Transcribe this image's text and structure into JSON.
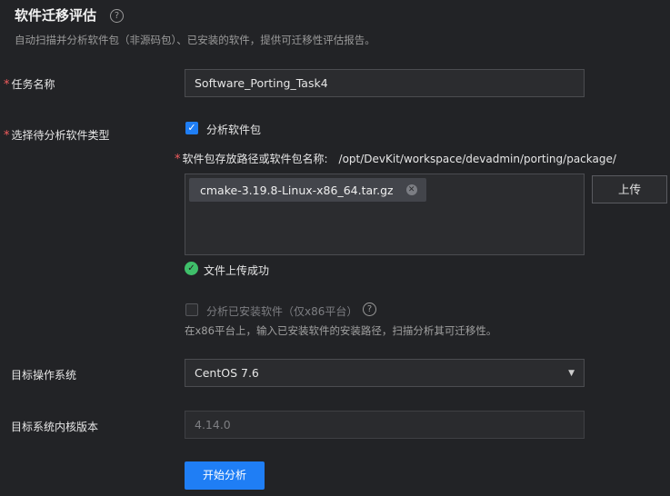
{
  "header": {
    "title": "软件迁移评估",
    "subtitle": "自动扫描并分析软件包（非源码包）、已安装的软件，提供可迁移性评估报告。"
  },
  "task_name": {
    "label": "任务名称",
    "value": "Software_Porting_Task4"
  },
  "software_type": {
    "label": "选择待分析软件类型",
    "analyze_package": {
      "label": "分析软件包",
      "checked": true,
      "path_label": "软件包存放路径或软件包名称:",
      "path_value": "/opt/DevKit/workspace/devadmin/porting/package/",
      "files": [
        "cmake-3.19.8-Linux-x86_64.tar.gz"
      ],
      "upload_label": "上传",
      "status": "文件上传成功"
    },
    "analyze_installed": {
      "label": "分析已安装软件（仅x86平台）",
      "checked": false,
      "hint": "在x86平台上，输入已安装软件的安装路径，扫描分析其可迁移性。"
    }
  },
  "target_os": {
    "label": "目标操作系统",
    "value": "CentOS 7.6"
  },
  "target_kernel": {
    "label": "目标系统内核版本",
    "value": "4.14.0"
  },
  "start_button": "开始分析",
  "colors": {
    "background": "#222326",
    "primary": "#1f7ef5",
    "success": "#3fbf6a",
    "required": "#f45c5e"
  }
}
